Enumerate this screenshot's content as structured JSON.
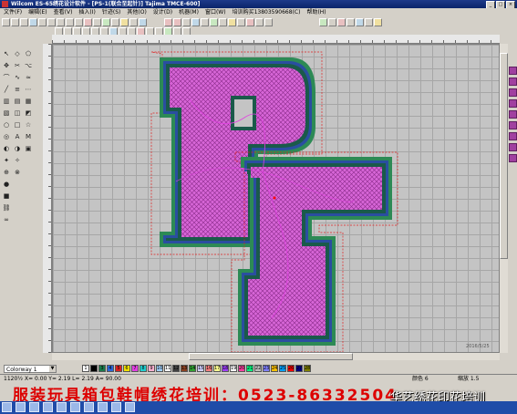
{
  "window": {
    "title": "Wilcom ES-65绣花设计软件 - [PS-1(联合至起针)]          Tajima TMCE-600]",
    "buttons": [
      "_",
      "□",
      "×"
    ]
  },
  "menu": [
    "文件(F)",
    "编辑(E)",
    "查看(V)",
    "插入(I)",
    "针迹(S)",
    "其他(O)",
    "设计(D)",
    "机器(M)",
    "窗口(W)",
    "培训购买13803590668(C)",
    "帮助(H)"
  ],
  "colorway": {
    "label": "Colorway 1"
  },
  "palette": [
    "#ffffff",
    "#000000",
    "#1a7a4a",
    "#2a66d8",
    "#e02020",
    "#f0e000",
    "#e040e0",
    "#20d0d0",
    "#ffb0d0",
    "#a0d0ff",
    "#ffffff",
    "#404040",
    "#8a4020",
    "#30a030",
    "#d0d0ff",
    "#ff8080",
    "#ffff90",
    "#a040ff",
    "#ffffff",
    "#ff40a0",
    "#00ff80",
    "#c0c0c0",
    "#8080ff",
    "#ffc000",
    "#00a0ff",
    "#ff0000",
    "#000080",
    "#808000"
  ],
  "palette_labels": [
    "1",
    "2",
    "3",
    "4",
    "5",
    "6",
    "7",
    "8",
    "9",
    "10",
    "11",
    "12",
    "13",
    "14",
    "15",
    "16",
    "17",
    "18",
    "19",
    "20",
    "21",
    "22",
    "23",
    "24",
    "25",
    "26",
    "27",
    "28"
  ],
  "status": {
    "coords": "1120½ X=  0.00 Y=  2.19 L=  2.19 A= 90.00",
    "colors": "颜色  6",
    "zoom": "缩放  1.5"
  },
  "canvas": {
    "date": "2016/5/25"
  },
  "ad": "服装玩具箱包鞋帽绣花培训：0523-86332504",
  "watermark": "华艺绣花印花培训"
}
